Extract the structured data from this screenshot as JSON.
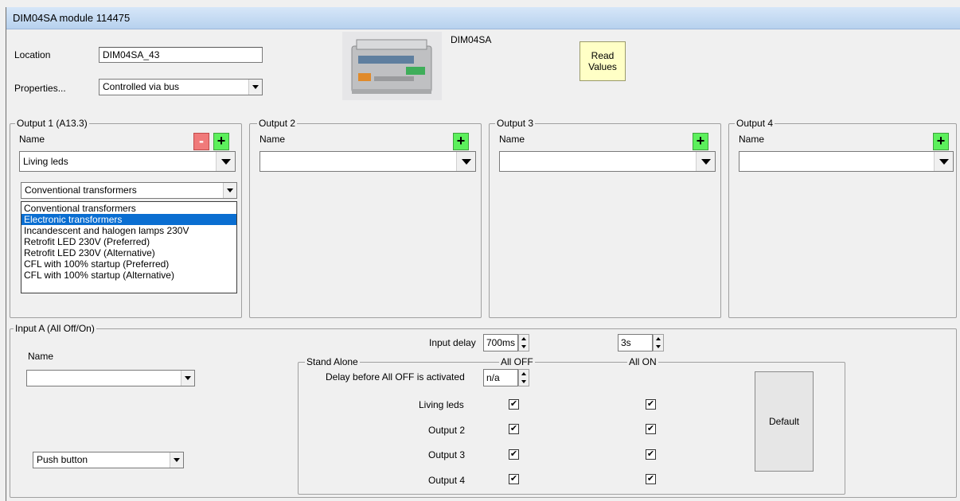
{
  "window": {
    "title": "DIM04SA module 114475"
  },
  "module": {
    "location_label": "Location",
    "location_value": "DIM04SA_43",
    "properties_label": "Properties...",
    "properties_value": "Controlled via bus",
    "image_caption": "DIM04SA",
    "read_values_line1": "Read",
    "read_values_line2": "Values"
  },
  "outputs": [
    {
      "title": "Output 1 (A13.3)",
      "name_label": "Name",
      "name_value": "Living leds",
      "load_type": "Conventional transformers",
      "plus": "+",
      "minus": "-"
    },
    {
      "title": "Output 2",
      "name_label": "Name",
      "name_value": "",
      "plus": "+"
    },
    {
      "title": "Output 3",
      "name_label": "Name",
      "name_value": "",
      "plus": "+"
    },
    {
      "title": "Output 4",
      "name_label": "Name",
      "name_value": "",
      "plus": "+"
    }
  ],
  "load_type_options": [
    "Conventional transformers",
    "Electronic transformers",
    "Incandescent and halogen lamps 230V",
    "Retrofit LED 230V (Preferred)",
    "Retrofit LED 230V (Alternative)",
    "CFL with 100% startup (Preferred)",
    "CFL with 100% startup (Alternative)"
  ],
  "load_type_selected_index": 1,
  "input_a": {
    "title": "Input A (All Off/On)",
    "name_label": "Name",
    "name_value": "",
    "button_type": "Push button",
    "input_delay_label": "Input delay",
    "input_delay_value": "700ms",
    "second_delay_value": "3s",
    "standalone_title": "Stand Alone",
    "all_off_label": "All OFF",
    "all_on_label": "All ON",
    "delay_before_label": "Delay before All OFF is activated",
    "delay_before_value": "n/a",
    "rows": [
      {
        "label": "Living leds",
        "all_off": true,
        "all_on": true
      },
      {
        "label": "Output 2",
        "all_off": true,
        "all_on": true
      },
      {
        "label": "Output 3",
        "all_off": true,
        "all_on": true
      },
      {
        "label": "Output 4",
        "all_off": true,
        "all_on": true
      }
    ],
    "default_label": "Default",
    "check_glyph": "✔"
  }
}
